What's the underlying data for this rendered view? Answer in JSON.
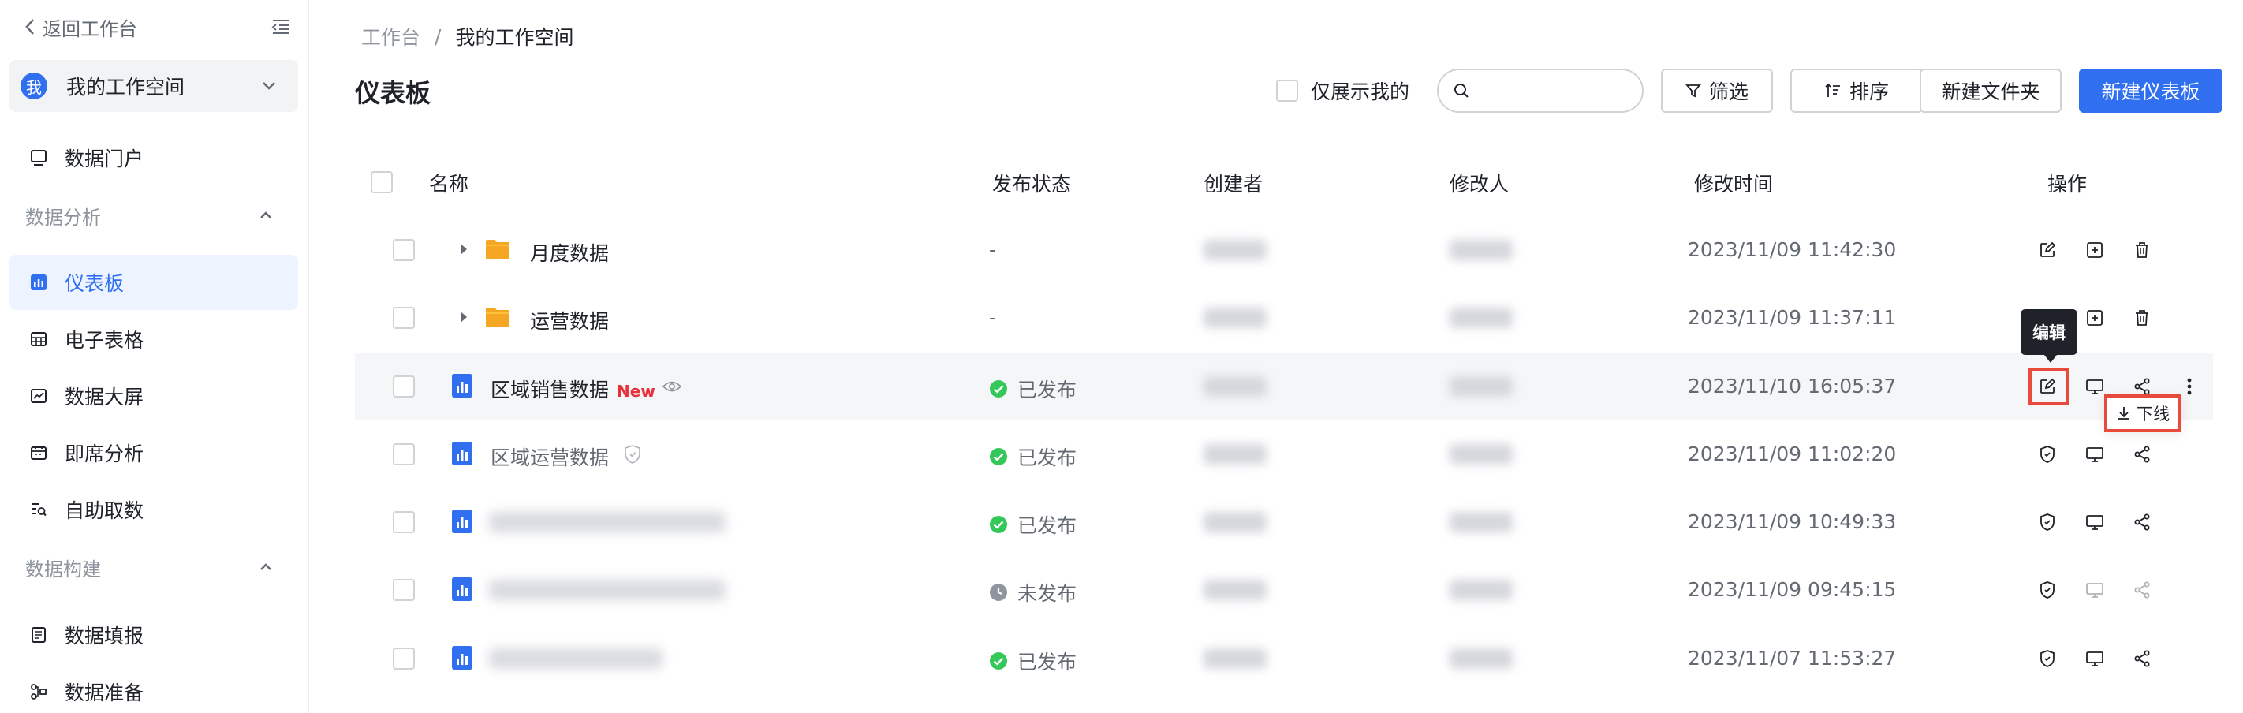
{
  "sidebar": {
    "back_label": "返回工作台",
    "workspace": {
      "avatar_text": "我",
      "name": "我的工作空间"
    },
    "items": [
      {
        "label": "数据门户",
        "icon": "monitor-icon"
      },
      {
        "label": "仪表板",
        "icon": "dashboard-icon",
        "active": true
      },
      {
        "label": "电子表格",
        "icon": "table-icon"
      },
      {
        "label": "数据大屏",
        "icon": "screen-chart-icon"
      },
      {
        "label": "即席分析",
        "icon": "calendar-icon"
      },
      {
        "label": "自助取数",
        "icon": "list-search-icon"
      },
      {
        "label": "数据填报",
        "icon": "form-icon"
      },
      {
        "label": "数据准备",
        "icon": "flow-icon"
      }
    ],
    "groups": [
      {
        "label": "数据分析"
      },
      {
        "label": "数据构建"
      }
    ]
  },
  "breadcrumb": {
    "root": "工作台",
    "separator": "/",
    "current": "我的工作空间"
  },
  "page_title": "仪表板",
  "toolbar": {
    "only_mine_label": "仅展示我的",
    "search_placeholder": "",
    "filter_label": "筛选",
    "sort_label": "排序",
    "new_folder_label": "新建文件夹",
    "new_dashboard_label": "新建仪表板"
  },
  "table": {
    "columns": [
      "名称",
      "发布状态",
      "创建者",
      "修改人",
      "修改时间",
      "操作"
    ],
    "rows": [
      {
        "type": "folder",
        "name": "月度数据",
        "status": "-",
        "modified": "2023/11/09 11:42:30"
      },
      {
        "type": "folder",
        "name": "运营数据",
        "status": "-",
        "modified": "2023/11/09 11:37:11"
      },
      {
        "type": "dashboard",
        "name": "区域销售数据",
        "badge": "New",
        "status": "已发布",
        "modified": "2023/11/10 16:05:37"
      },
      {
        "type": "dashboard",
        "name": "区域运营数据",
        "status": "已发布",
        "modified": "2023/11/09 11:02:20"
      },
      {
        "type": "dashboard",
        "name": "",
        "status": "已发布",
        "modified": "2023/11/09 10:49:33"
      },
      {
        "type": "dashboard",
        "name": "",
        "status": "未发布",
        "modified": "2023/11/09 09:45:15"
      },
      {
        "type": "dashboard",
        "name": "",
        "status": "已发布",
        "modified": "2023/11/07 11:53:27"
      }
    ]
  },
  "tooltip_edit": "编辑",
  "offline_label": "下线",
  "colors": {
    "accent": "#2f6ff0",
    "published": "#34c759",
    "unpublished": "#8f959e",
    "new_badge": "#e8313a",
    "highlight": "#e84b3c"
  }
}
